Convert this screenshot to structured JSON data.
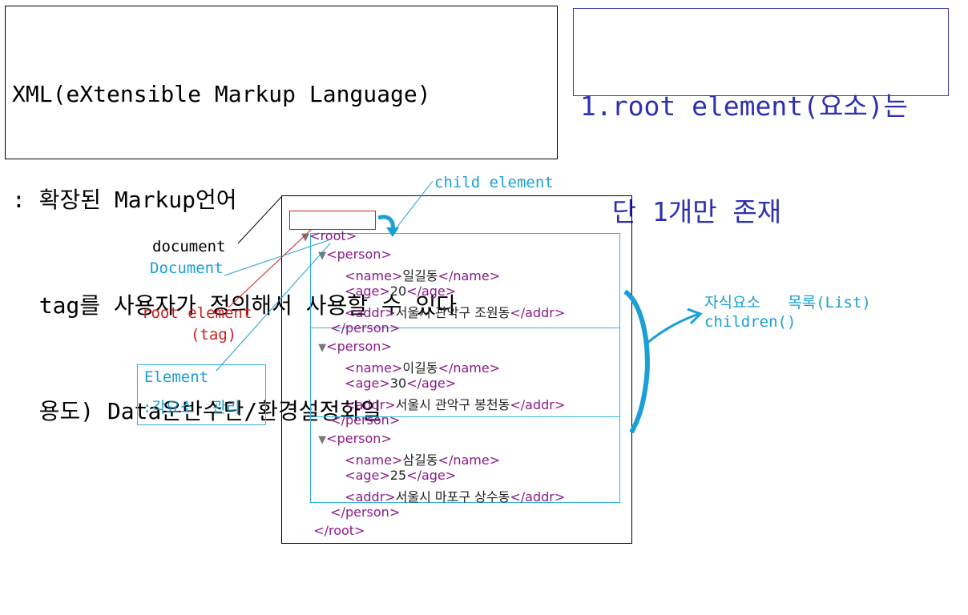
{
  "definition": {
    "line1": "XML(eXtensible Markup Language)",
    "line2": ": 확장된 Markup언어",
    "line3": "  tag를 사용자가 정의해서 사용할 수 있다",
    "line4": "  용도) Data운반수단/환경설정화일"
  },
  "rule": {
    "line1": "1.root element(요소)는",
    "line2": "  단 1개만 존재"
  },
  "labels": {
    "child_element": "child element",
    "document_lower": "document",
    "document_upper": "Document",
    "root_element": "root element",
    "root_tag": "(tag)",
    "element_title": "Element",
    "element_desc": ":각요소  관리",
    "children_list": "자식요소   목록(List)",
    "children_method": "children()"
  },
  "xml": {
    "root_open": "<root>",
    "root_close": "</root>",
    "persons": [
      {
        "open": "<person>",
        "name_open": "<name>",
        "name": "일길동",
        "name_close": "</name>",
        "age_open": "<age>",
        "age": "20",
        "age_close": "</age>",
        "addr_open": "<addr>",
        "addr": "서울시 관악구 조원동",
        "addr_close": "</addr>",
        "close": "</person>"
      },
      {
        "open": "<person>",
        "name_open": "<name>",
        "name": "이길동",
        "name_close": "</name>",
        "age_open": "<age>",
        "age": "30",
        "age_close": "</age>",
        "addr_open": "<addr>",
        "addr": "서울시 관악구 봉천동",
        "addr_close": "</addr>",
        "close": "</person>"
      },
      {
        "open": "<person>",
        "name_open": "<name>",
        "name": "삼길동",
        "name_close": "</name>",
        "age_open": "<age>",
        "age": "25",
        "age_close": "</age>",
        "addr_open": "<addr>",
        "addr": "서울시 마포구 상수동",
        "addr_close": "</addr>",
        "close": "</person>"
      }
    ]
  },
  "colors": {
    "tag": "#8b1a8b",
    "annotation_blue": "#1a9fd6",
    "annotation_red": "#d01c1c",
    "rule_text": "#2f30b0"
  }
}
